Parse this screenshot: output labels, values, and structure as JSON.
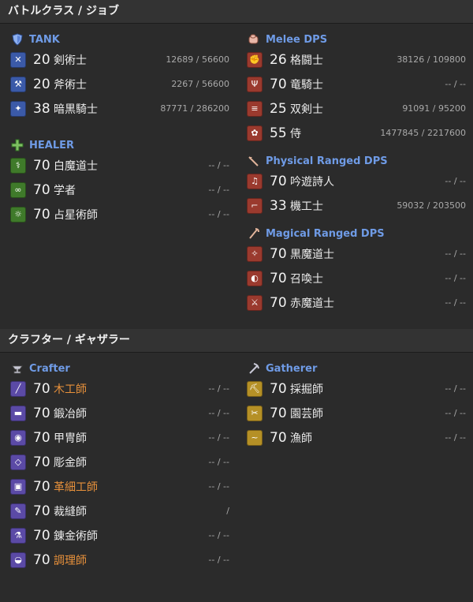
{
  "battle_header": "バトルクラス / ジョブ",
  "craft_header": "クラフター / ギャザラー",
  "roles": {
    "tank": {
      "label": "TANK",
      "jobs": [
        {
          "level": "20",
          "name": "剣術士",
          "exp": "12689 / 56600",
          "icon": "sword-icon"
        },
        {
          "level": "20",
          "name": "斧術士",
          "exp": "2267 / 56600",
          "icon": "axe-icon"
        },
        {
          "level": "38",
          "name": "暗黒騎士",
          "exp": "87771 / 286200",
          "icon": "dark-knight-icon"
        }
      ]
    },
    "healer": {
      "label": "HEALER",
      "jobs": [
        {
          "level": "70",
          "name": "白魔道士",
          "exp": "-- / --",
          "icon": "white-mage-icon"
        },
        {
          "level": "70",
          "name": "学者",
          "exp": "-- / --",
          "icon": "scholar-icon"
        },
        {
          "level": "70",
          "name": "占星術師",
          "exp": "-- / --",
          "icon": "astrologian-icon"
        }
      ]
    },
    "melee": {
      "label": "Melee DPS",
      "jobs": [
        {
          "level": "26",
          "name": "格闘士",
          "exp": "38126 / 109800",
          "icon": "fist-icon"
        },
        {
          "level": "70",
          "name": "竜騎士",
          "exp": "-- / --",
          "icon": "dragoon-icon"
        },
        {
          "level": "25",
          "name": "双剣士",
          "exp": "91091 / 95200",
          "icon": "dagger-icon"
        },
        {
          "level": "55",
          "name": "侍",
          "exp": "1477845 / 2217600",
          "icon": "samurai-icon"
        }
      ]
    },
    "phys_ranged": {
      "label": "Physical Ranged DPS",
      "jobs": [
        {
          "level": "70",
          "name": "吟遊詩人",
          "exp": "-- / --",
          "icon": "bard-icon"
        },
        {
          "level": "33",
          "name": "機工士",
          "exp": "59032 / 203500",
          "icon": "machinist-icon"
        }
      ]
    },
    "mag_ranged": {
      "label": "Magical Ranged DPS",
      "jobs": [
        {
          "level": "70",
          "name": "黒魔道士",
          "exp": "-- / --",
          "icon": "black-mage-icon"
        },
        {
          "level": "70",
          "name": "召喚士",
          "exp": "-- / --",
          "icon": "summoner-icon"
        },
        {
          "level": "70",
          "name": "赤魔道士",
          "exp": "-- / --",
          "icon": "red-mage-icon"
        }
      ]
    },
    "crafter": {
      "label": "Crafter",
      "jobs": [
        {
          "level": "70",
          "name": "木工師",
          "exp": "-- / --",
          "icon": "carpenter-icon",
          "highlight": true
        },
        {
          "level": "70",
          "name": "鍛冶師",
          "exp": "-- / --",
          "icon": "blacksmith-icon"
        },
        {
          "level": "70",
          "name": "甲冑師",
          "exp": "-- / --",
          "icon": "armorer-icon"
        },
        {
          "level": "70",
          "name": "彫金師",
          "exp": "-- / --",
          "icon": "goldsmith-icon"
        },
        {
          "level": "70",
          "name": "革細工師",
          "exp": "-- / --",
          "icon": "leatherworker-icon",
          "highlight": true
        },
        {
          "level": "70",
          "name": "裁縫師",
          "exp": "/",
          "icon": "weaver-icon"
        },
        {
          "level": "70",
          "name": "錬金術師",
          "exp": "-- / --",
          "icon": "alchemist-icon"
        },
        {
          "level": "70",
          "name": "調理師",
          "exp": "-- / --",
          "icon": "culinarian-icon",
          "highlight": true
        }
      ]
    },
    "gatherer": {
      "label": "Gatherer",
      "jobs": [
        {
          "level": "70",
          "name": "採掘師",
          "exp": "-- / --",
          "icon": "miner-icon"
        },
        {
          "level": "70",
          "name": "園芸師",
          "exp": "-- / --",
          "icon": "botanist-icon"
        },
        {
          "level": "70",
          "name": "漁師",
          "exp": "-- / --",
          "icon": "fisher-icon"
        }
      ]
    }
  },
  "colors": {
    "background": "#2b2b2b",
    "role_label": "#6f9be6",
    "highlight_name": "#e8913b"
  }
}
